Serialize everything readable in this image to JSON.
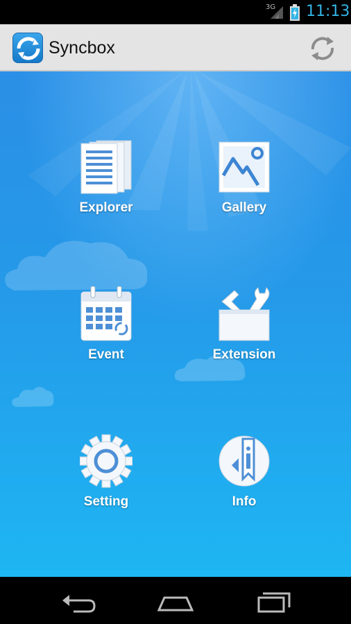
{
  "status_bar": {
    "network": "3G",
    "time": "11:13"
  },
  "app_bar": {
    "title": "Syncbox",
    "icons": {
      "app": "syncbox-logo-icon",
      "action": "sync-icon"
    }
  },
  "menu": [
    {
      "label": "Explorer",
      "icon": "document-stack-icon"
    },
    {
      "label": "Gallery",
      "icon": "picture-icon"
    },
    {
      "label": "Event",
      "icon": "calendar-icon"
    },
    {
      "label": "Extension",
      "icon": "toolbox-icon"
    },
    {
      "label": "Setting",
      "icon": "gear-icon"
    },
    {
      "label": "Info",
      "icon": "info-icon"
    }
  ],
  "nav_bar": {
    "icons": [
      "back-icon",
      "home-icon",
      "recent-apps-icon"
    ]
  },
  "colors": {
    "status_clock": "#33b5e5",
    "action_bar": "#e4e4e4",
    "background_top": "#2a8fe6",
    "background_bottom": "#1eb6f3"
  }
}
